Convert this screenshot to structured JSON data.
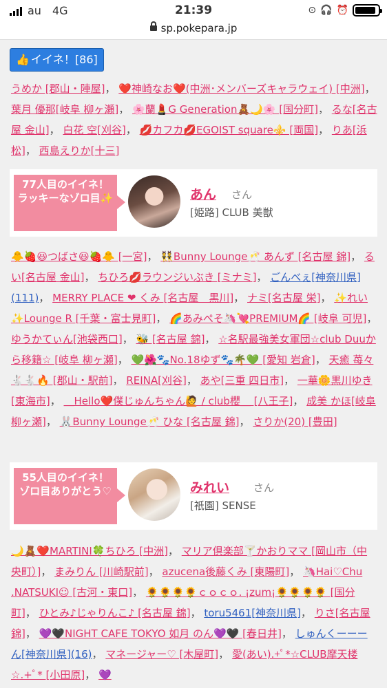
{
  "status": {
    "carrier": "au",
    "network": "4G",
    "time": "21:39",
    "battery_level": 0.9
  },
  "url": "sp.pokepara.jp",
  "like_button": {
    "icon": "thumbs-up-icon",
    "label": "イイネ！[86]"
  },
  "block1": [
    {
      "text": "うめか [郡山・陣屋]"
    },
    {
      "text": "❤️神崎なお❤️(中洲･メンバーズキャラウェイ) [中洲]"
    },
    {
      "text": "葉月 優那[岐阜 柳ヶ瀬]"
    },
    {
      "text": "🌸蘭💄G Generation🧸🌙🌸 [国分町]"
    },
    {
      "text": "るな[名古屋 金山]"
    },
    {
      "text": "白花 空[刈谷]"
    },
    {
      "text": "💋カフカ💋EGOIST square⚜️ [両国]"
    },
    {
      "text": "りあ[浜松]"
    },
    {
      "text": "西島えりか[十三]"
    }
  ],
  "card1": {
    "badge": "77人目のイイネ！\nラッキーなゾロ目✨",
    "name": "あん",
    "honorific": "さん",
    "store": "[姫路] CLUB 美獣"
  },
  "block2": [
    {
      "text": "🐥🍓😆つばさ😆🍓🐥 [一宮]"
    },
    {
      "text": "👯Bunny Lounge🥂 あんず [名古屋 錦]"
    },
    {
      "text": "るい[名古屋 金山]"
    },
    {
      "text": "ちひろ💋ラウンジいぶき [ミナミ]"
    },
    {
      "text": "ごんべぇ[神奈川県](111)",
      "blue": true
    },
    {
      "text": "MERRY PLACE ❤︎ くみ [名古屋　黒川]"
    },
    {
      "text": "ナミ[名古屋 栄]"
    },
    {
      "text": "✨れい✨Lounge R [千葉・富士見町]"
    },
    {
      "text": "🌈あみぺそ🦄💘PREMIUM🌈 [岐阜 可児]"
    },
    {
      "text": "ゆうかてぃん[池袋西口]"
    },
    {
      "text": "🐝 [名古屋 錦]"
    },
    {
      "text": "☆名駅最強美女軍団☆club Duuから移籍☆ [岐阜 柳ヶ瀬]"
    },
    {
      "text": "💚🌺🐾No.18ゆず🐾🌴💚 [愛知 岩倉]"
    },
    {
      "text": "天癒 苺々🐇🐇🔥 [郡山・駅前]"
    },
    {
      "text": "REINA[刈谷]"
    },
    {
      "text": "あや[三重 四日市]"
    },
    {
      "text": "一華🌼黒川ゆき [東海市]"
    },
    {
      "text": "＿Hello❤️僕じゅんちゃん🙋 / club櫻＿ [八王子]"
    },
    {
      "text": "成美 かほ[岐阜 柳ヶ瀬]"
    },
    {
      "text": "🐰Bunny Lounge🥂 ひな [名古屋 錦]"
    },
    {
      "text": "さりか(20) [豊田]"
    }
  ],
  "card2": {
    "badge": "55人目のイイネ！\nゾロ目ありがとう♡",
    "name": "みれい",
    "honorific": "さん",
    "store": "[祇園] SENSE"
  },
  "block3": [
    {
      "text": "🌙🧸❤️MARTINI🍀ちひろ [中洲]"
    },
    {
      "text": "マリア倶楽部🍸かおりママ [岡山市（中央町）]"
    },
    {
      "text": "まみりん [川崎駅前]"
    },
    {
      "text": "azucena後藤くみ [東陽町]"
    },
    {
      "text": "🦄Hai♡Chu .NATSUKI☺ [古河・東口]"
    },
    {
      "text": "🌻🌻🌻🌻ｃｏｃｏ. ¡zum¡🌻🌻🌻🌻 [国分町]"
    },
    {
      "text": "ひとみ♪じゃりんこ♪ [名古屋 錦]"
    },
    {
      "text": "toru5461[神奈川県]",
      "blue": true
    },
    {
      "text": "りさ[名古屋 錦]"
    },
    {
      "text": "💜🖤NIGHT CAFE TOKYO 如月 のん💜🖤 [春日井]"
    },
    {
      "text": "しゅんくーーーん[神奈川県](16)",
      "blue": true
    },
    {
      "text": "マネージャー♡ [木屋町]"
    },
    {
      "text": "愛(あい).+ﾟ*☆CLUB摩天楼☆.+ﾟ* [小田原]"
    },
    {
      "text": "💜"
    }
  ]
}
